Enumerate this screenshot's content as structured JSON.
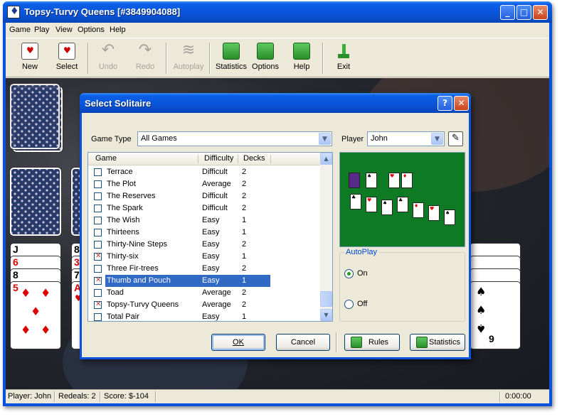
{
  "window": {
    "title": "Topsy-Turvy Queens [#3849904088]"
  },
  "menu": {
    "game": "Game",
    "play": "Play",
    "view": "View",
    "options": "Options",
    "help": "Help"
  },
  "toolbar": {
    "new": "New",
    "select": "Select",
    "undo": "Undo",
    "redo": "Redo",
    "autoplay": "Autoplay",
    "statistics": "Statistics",
    "options": "Options",
    "help": "Help",
    "exit": "Exit"
  },
  "table_cards": {
    "left_ranks": [
      "J",
      "6",
      "8",
      "5"
    ],
    "mid_ranks": [
      "8",
      "3",
      "7",
      "A"
    ],
    "right_ranks": [
      "9"
    ]
  },
  "dialog": {
    "title": "Select Solitaire",
    "game_type_label": "Game Type",
    "game_type_value": "All Games",
    "player_label": "Player",
    "player_value": "John",
    "columns": {
      "game": "Game",
      "difficulty": "Difficulty",
      "decks": "Decks"
    },
    "games": [
      {
        "name": "Terrace",
        "difficulty": "Difficult",
        "decks": "2",
        "checked": false,
        "selected": false
      },
      {
        "name": "The Plot",
        "difficulty": "Average",
        "decks": "2",
        "checked": false,
        "selected": false
      },
      {
        "name": "The Reserves",
        "difficulty": "Difficult",
        "decks": "2",
        "checked": false,
        "selected": false
      },
      {
        "name": "The Spark",
        "difficulty": "Difficult",
        "decks": "2",
        "checked": false,
        "selected": false
      },
      {
        "name": "The Wish",
        "difficulty": "Easy",
        "decks": "1",
        "checked": false,
        "selected": false
      },
      {
        "name": "Thirteens",
        "difficulty": "Easy",
        "decks": "1",
        "checked": false,
        "selected": false
      },
      {
        "name": "Thirty-Nine Steps",
        "difficulty": "Easy",
        "decks": "2",
        "checked": false,
        "selected": false
      },
      {
        "name": "Thirty-six",
        "difficulty": "Easy",
        "decks": "1",
        "checked": true,
        "selected": false
      },
      {
        "name": "Three Fir-trees",
        "difficulty": "Easy",
        "decks": "2",
        "checked": false,
        "selected": false
      },
      {
        "name": "Thumb and Pouch",
        "difficulty": "Easy",
        "decks": "1",
        "checked": true,
        "selected": true
      },
      {
        "name": "Toad",
        "difficulty": "Average",
        "decks": "2",
        "checked": false,
        "selected": false
      },
      {
        "name": "Topsy-Turvy Queens",
        "difficulty": "Average",
        "decks": "2",
        "checked": true,
        "selected": false
      },
      {
        "name": "Total Pair",
        "difficulty": "Easy",
        "decks": "1",
        "checked": false,
        "selected": false
      }
    ],
    "autoplay": {
      "title": "AutoPlay",
      "on": "On",
      "off": "Off",
      "selected": "On"
    },
    "buttons": {
      "ok": "OK",
      "cancel": "Cancel",
      "rules": "Rules",
      "statistics": "Statistics"
    }
  },
  "status": {
    "player": "Player: John",
    "redeals": "Redeals: 2",
    "score": "Score: $-104",
    "time": "0:00:00"
  },
  "colors": {
    "titlebar": "#0a52dd",
    "selection": "#316ac5",
    "felt": "#0f7a24",
    "face": "#ece9d8"
  }
}
